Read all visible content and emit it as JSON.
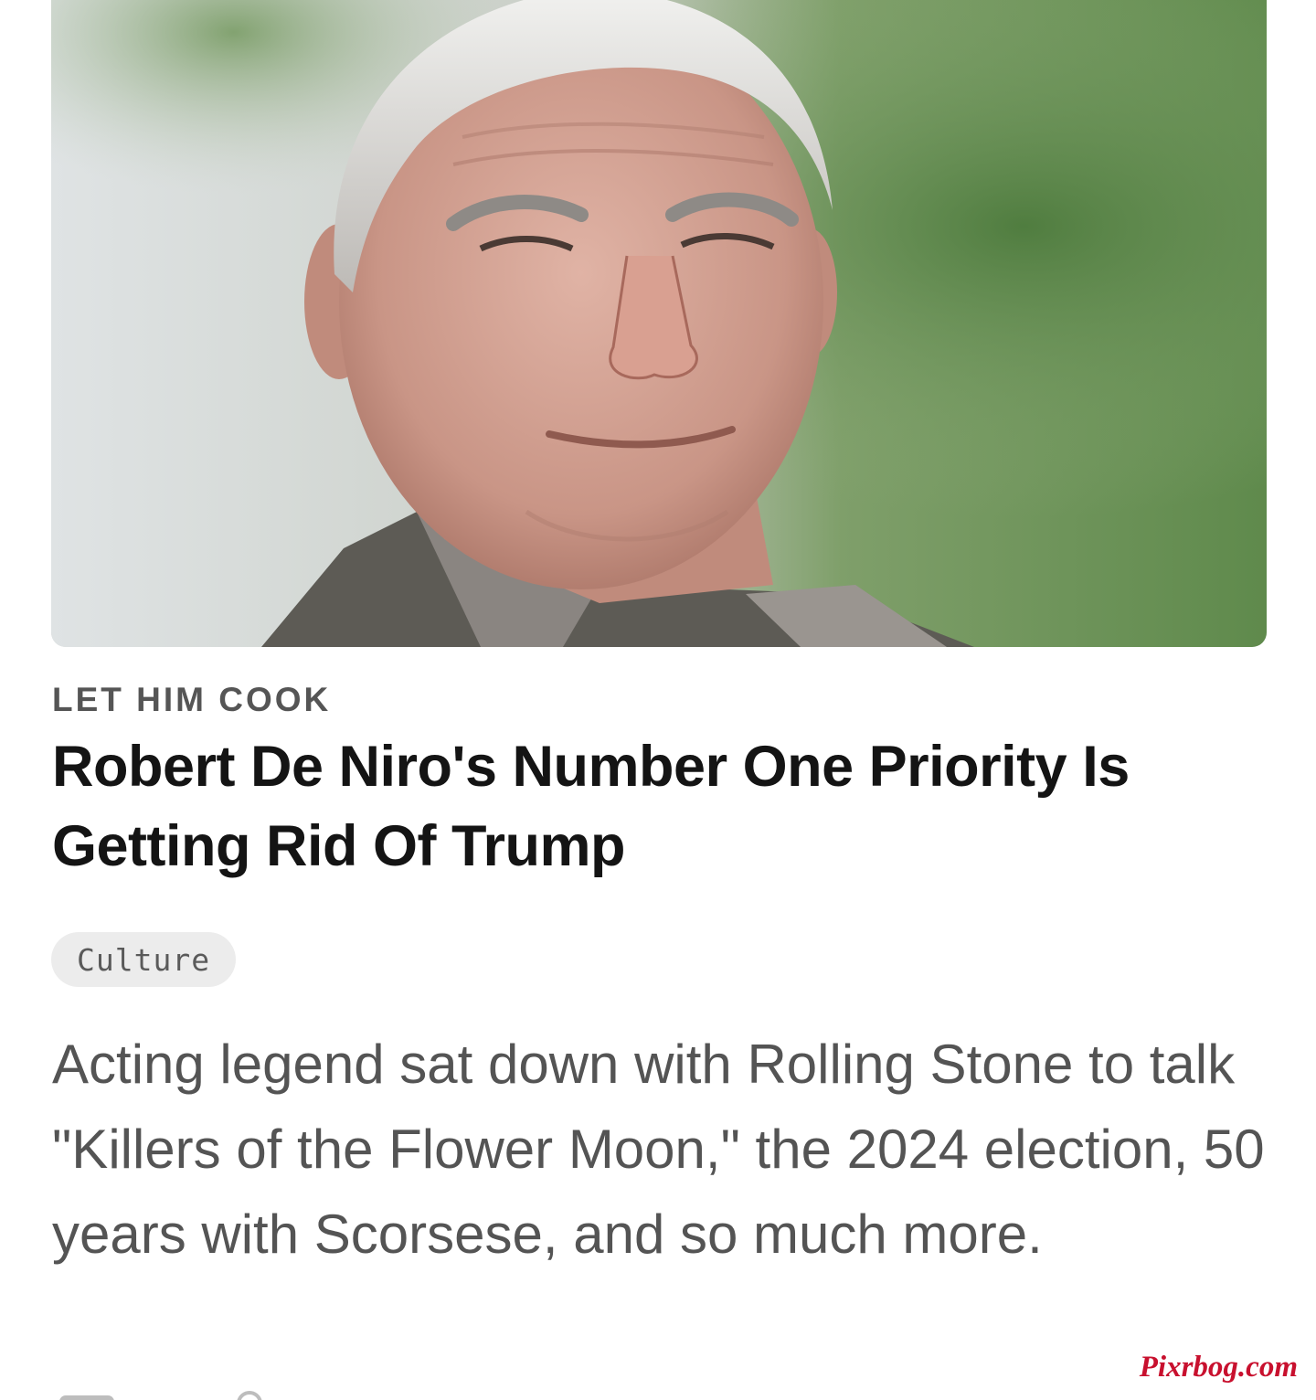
{
  "article": {
    "kicker": "LET HIM COOK",
    "headline": "Robert De Niro's Number One Priority Is Getting Rid Of Trump",
    "tag": "Culture",
    "dek": "Acting legend sat down with Rolling Stone to talk \"Killers of the Flower Moon,\" the 2024 election, 50 years with Scorsese, and so much more."
  },
  "watermark": "Pixrbog.com",
  "colors": {
    "kicker": "#555555",
    "headline": "#141414",
    "dek": "#545454",
    "tag_bg": "#ececec",
    "watermark": "#c8102e"
  }
}
